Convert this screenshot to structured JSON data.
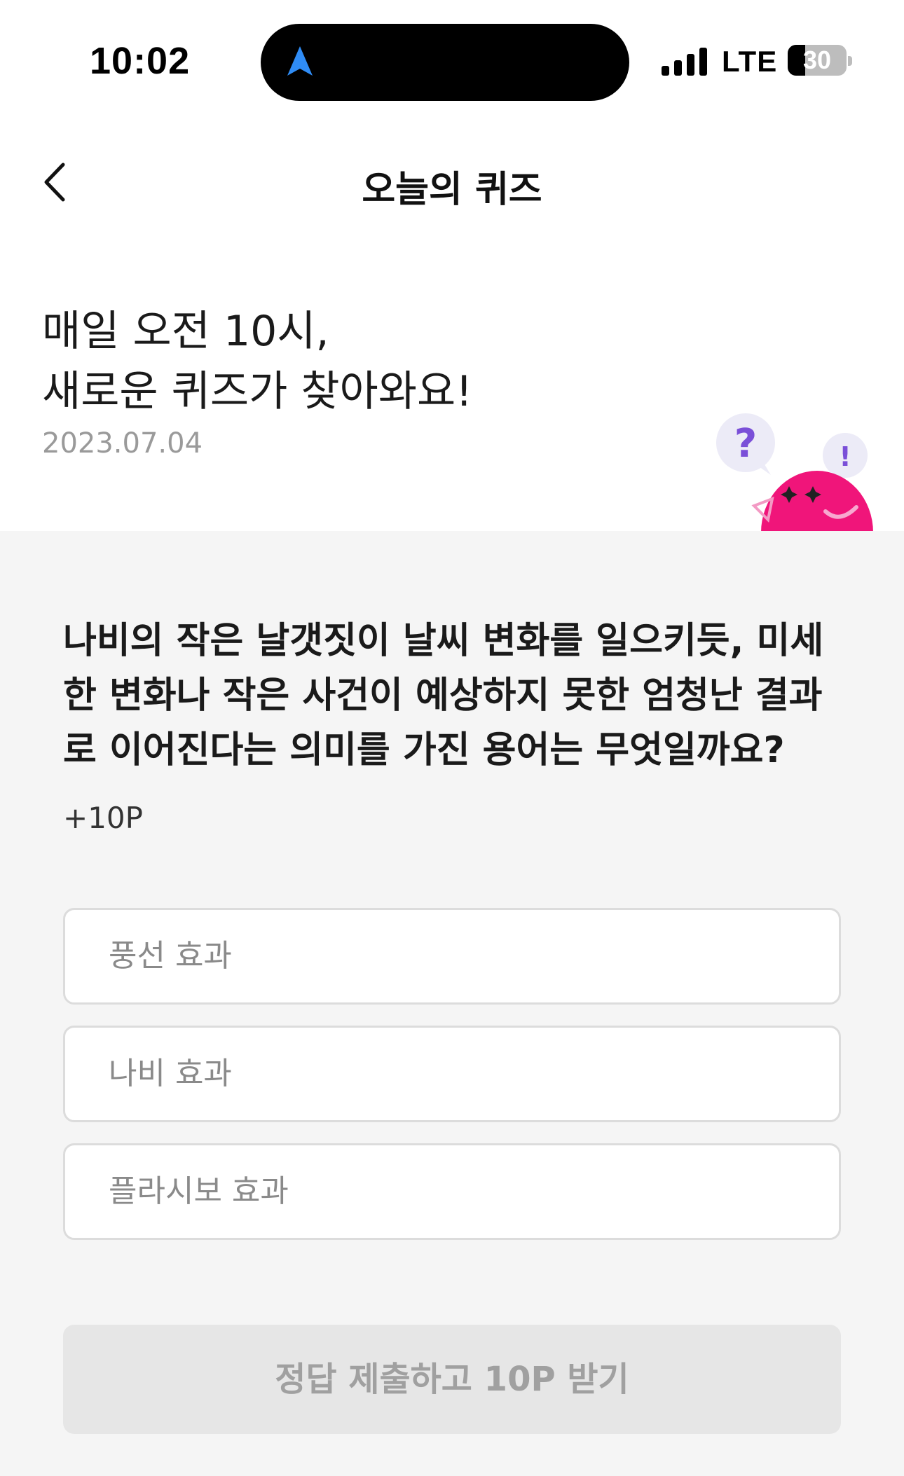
{
  "status_bar": {
    "time": "10:02",
    "network": "LTE",
    "battery": "30",
    "battery_level_percent": 30,
    "icons": [
      "navigation-arrow-icon",
      "signal-icon",
      "battery-icon"
    ]
  },
  "header": {
    "title": "오늘의 퀴즈",
    "back_icon": "chevron-left-icon"
  },
  "intro": {
    "line1": "매일 오전 10시,",
    "line2": "새로운 퀴즈가 찾아와요!",
    "date": "2023.07.04"
  },
  "mascot": {
    "question_mark": "?",
    "exclamation_mark": "!"
  },
  "quiz": {
    "question": "나비의 작은 날갯짓이 날씨 변화를 일으키듯, 미세한 변화나 작은 사건이 예상하지 못한 엄청난 결과로 이어진다는 의미를 가진 용어는 무엇일까요?",
    "points": "+10P",
    "options": [
      {
        "label": "풍선 효과"
      },
      {
        "label": "나비 효과"
      },
      {
        "label": "플라시보 효과"
      }
    ],
    "submit_label": "정답 제출하고 10P 받기"
  },
  "colors": {
    "panel_bg": "#f5f5f5",
    "mascot_pink": "#f0157a",
    "bubble_purple": "#7a4fd8",
    "nav_blue": "#2f8cf5",
    "submit_disabled_bg": "#e6e6e6"
  }
}
